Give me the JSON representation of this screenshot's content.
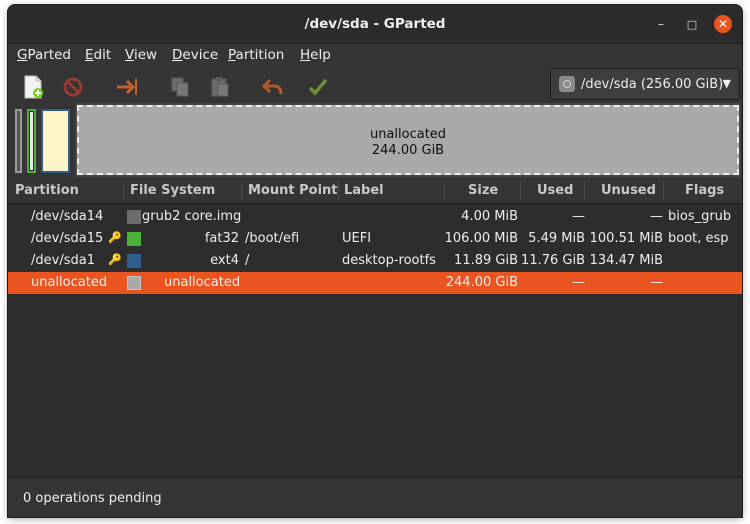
{
  "window": {
    "title": "/dev/sda - GParted"
  },
  "titlebar_buttons": {
    "minimize": "–",
    "maximize": "□",
    "close": "✕"
  },
  "menu": [
    {
      "label": "GParted",
      "mnemonic": "G"
    },
    {
      "label": "Edit",
      "mnemonic": "E"
    },
    {
      "label": "View",
      "mnemonic": "V"
    },
    {
      "label": "Device",
      "mnemonic": "D"
    },
    {
      "label": "Partition",
      "mnemonic": "P"
    },
    {
      "label": "Help",
      "mnemonic": "H"
    }
  ],
  "toolbar": {
    "icons": [
      "new-partition-icon",
      "delete-icon",
      "resize-move-icon",
      "copy-icon",
      "paste-icon",
      "undo-icon",
      "apply-icon"
    ]
  },
  "device_selector": {
    "value": "/dev/sda (256.00 GiB)",
    "icon": "disk-icon"
  },
  "disk_map": {
    "unallocated_label": "unallocated",
    "unallocated_size": "244.00 GiB"
  },
  "table": {
    "columns": [
      "Partition",
      "File System",
      "Mount Point",
      "Label",
      "Size",
      "Used",
      "Unused",
      "Flags"
    ],
    "rows": [
      {
        "partition": "/dev/sda14",
        "locked": false,
        "fs_color": "#6b6b6b",
        "filesystem": "grub2 core.img",
        "mount": "",
        "label": "",
        "size": "4.00 MiB",
        "used": "—",
        "unused": "—",
        "flags": "bios_grub"
      },
      {
        "partition": "/dev/sda15",
        "locked": true,
        "fs_color": "#4caf3a",
        "filesystem": "fat32",
        "mount": "/boot/efi",
        "label": "UEFI",
        "size": "106.00 MiB",
        "used": "5.49 MiB",
        "unused": "100.51 MiB",
        "flags": "boot, esp"
      },
      {
        "partition": "/dev/sda1",
        "locked": true,
        "fs_color": "#2f5d8c",
        "filesystem": "ext4",
        "mount": "/",
        "label": "desktop-rootfs",
        "size": "11.89 GiB",
        "used": "11.76 GiB",
        "unused": "134.47 MiB",
        "flags": ""
      },
      {
        "partition": "unallocated",
        "locked": false,
        "fs_color": "#a9a9a9",
        "filesystem": "unallocated",
        "mount": "",
        "label": "",
        "size": "244.00 GiB",
        "used": "—",
        "unused": "—",
        "flags": "",
        "selected": true
      }
    ]
  },
  "status": {
    "text": "0 operations pending"
  },
  "colors": {
    "accent": "#e95420",
    "background": "#353535",
    "unallocated": "#a9a9a9"
  }
}
